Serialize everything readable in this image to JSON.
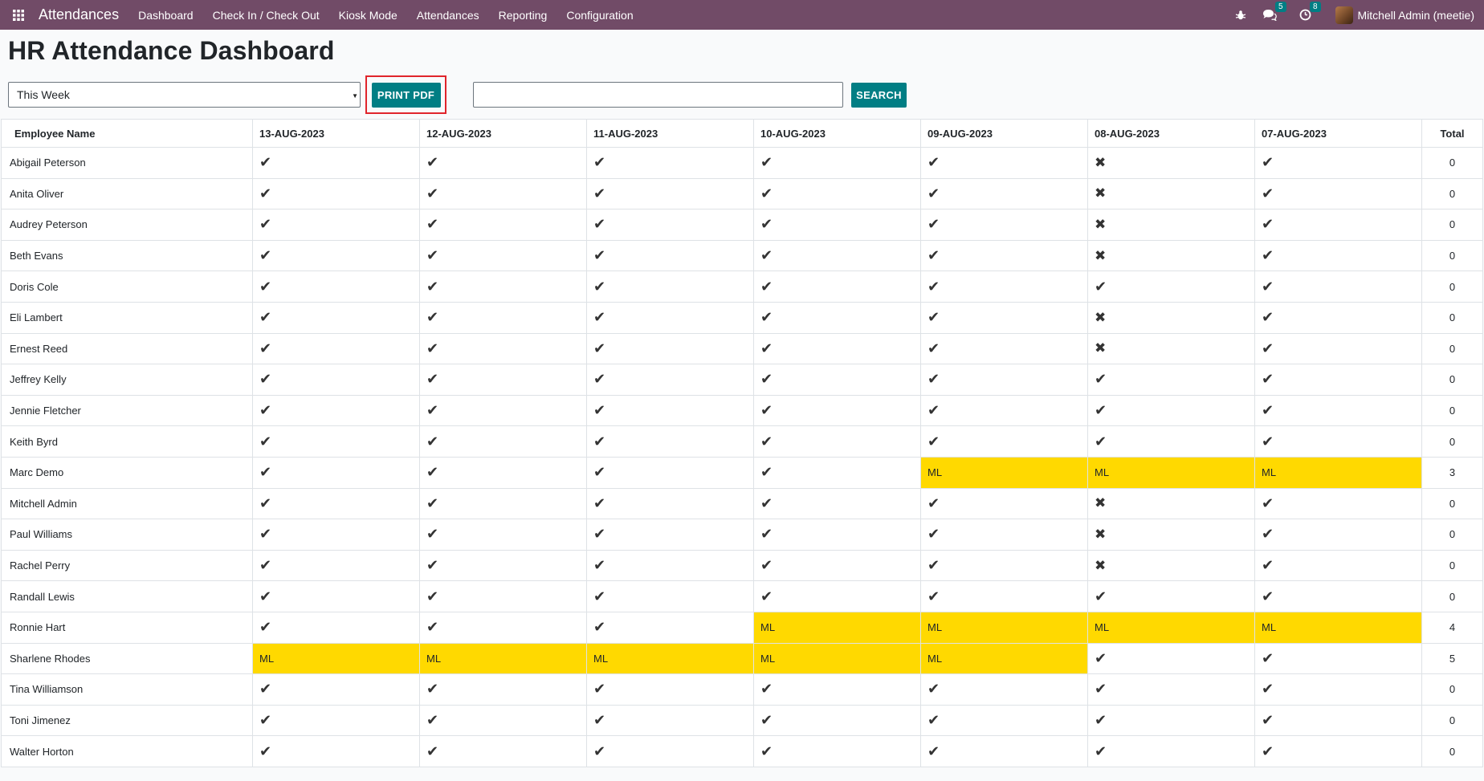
{
  "nav": {
    "brand": "Attendances",
    "menu": [
      "Dashboard",
      "Check In / Check Out",
      "Kiosk Mode",
      "Attendances",
      "Reporting",
      "Configuration"
    ],
    "messages_count": "5",
    "activities_count": "8",
    "user": "Mitchell Admin (meetie)"
  },
  "page": {
    "title": "HR Attendance Dashboard",
    "period": "This Week",
    "print_label": "PRINT PDF",
    "search_value": "",
    "search_label": "SEARCH"
  },
  "table": {
    "employee_header": "Employee Name",
    "total_header": "Total",
    "dates": [
      "13-AUG-2023",
      "12-AUG-2023",
      "11-AUG-2023",
      "10-AUG-2023",
      "09-AUG-2023",
      "08-AUG-2023",
      "07-AUG-2023"
    ],
    "symbols": {
      "P": "✔",
      "A": "✖",
      "ML": "ML"
    },
    "rows": [
      {
        "name": "Abigail Peterson",
        "days": [
          "P",
          "P",
          "P",
          "P",
          "P",
          "A",
          "P"
        ],
        "total": "0"
      },
      {
        "name": "Anita Oliver",
        "days": [
          "P",
          "P",
          "P",
          "P",
          "P",
          "A",
          "P"
        ],
        "total": "0"
      },
      {
        "name": "Audrey Peterson",
        "days": [
          "P",
          "P",
          "P",
          "P",
          "P",
          "A",
          "P"
        ],
        "total": "0"
      },
      {
        "name": "Beth Evans",
        "days": [
          "P",
          "P",
          "P",
          "P",
          "P",
          "A",
          "P"
        ],
        "total": "0"
      },
      {
        "name": "Doris Cole",
        "days": [
          "P",
          "P",
          "P",
          "P",
          "P",
          "P",
          "P"
        ],
        "total": "0"
      },
      {
        "name": "Eli Lambert",
        "days": [
          "P",
          "P",
          "P",
          "P",
          "P",
          "A",
          "P"
        ],
        "total": "0"
      },
      {
        "name": "Ernest Reed",
        "days": [
          "P",
          "P",
          "P",
          "P",
          "P",
          "A",
          "P"
        ],
        "total": "0"
      },
      {
        "name": "Jeffrey Kelly",
        "days": [
          "P",
          "P",
          "P",
          "P",
          "P",
          "P",
          "P"
        ],
        "total": "0"
      },
      {
        "name": "Jennie Fletcher",
        "days": [
          "P",
          "P",
          "P",
          "P",
          "P",
          "P",
          "P"
        ],
        "total": "0"
      },
      {
        "name": "Keith Byrd",
        "days": [
          "P",
          "P",
          "P",
          "P",
          "P",
          "P",
          "P"
        ],
        "total": "0"
      },
      {
        "name": "Marc Demo",
        "days": [
          "P",
          "P",
          "P",
          "P",
          "ML",
          "ML",
          "ML"
        ],
        "total": "3"
      },
      {
        "name": "Mitchell Admin",
        "days": [
          "P",
          "P",
          "P",
          "P",
          "P",
          "A",
          "P"
        ],
        "total": "0"
      },
      {
        "name": "Paul Williams",
        "days": [
          "P",
          "P",
          "P",
          "P",
          "P",
          "A",
          "P"
        ],
        "total": "0"
      },
      {
        "name": "Rachel Perry",
        "days": [
          "P",
          "P",
          "P",
          "P",
          "P",
          "A",
          "P"
        ],
        "total": "0"
      },
      {
        "name": "Randall Lewis",
        "days": [
          "P",
          "P",
          "P",
          "P",
          "P",
          "P",
          "P"
        ],
        "total": "0"
      },
      {
        "name": "Ronnie Hart",
        "days": [
          "P",
          "P",
          "P",
          "ML",
          "ML",
          "ML",
          "ML"
        ],
        "total": "4"
      },
      {
        "name": "Sharlene Rhodes",
        "days": [
          "ML",
          "ML",
          "ML",
          "ML",
          "ML",
          "P",
          "P"
        ],
        "total": "5"
      },
      {
        "name": "Tina Williamson",
        "days": [
          "P",
          "P",
          "P",
          "P",
          "P",
          "P",
          "P"
        ],
        "total": "0"
      },
      {
        "name": "Toni Jimenez",
        "days": [
          "P",
          "P",
          "P",
          "P",
          "P",
          "P",
          "P"
        ],
        "total": "0"
      },
      {
        "name": "Walter Horton",
        "days": [
          "P",
          "P",
          "P",
          "P",
          "P",
          "P",
          "P"
        ],
        "total": "0"
      }
    ]
  },
  "colors": {
    "navbar": "#714B67",
    "accent_teal": "#017e84",
    "leave_highlight": "#FFD900",
    "print_outline": "#e0242b"
  }
}
